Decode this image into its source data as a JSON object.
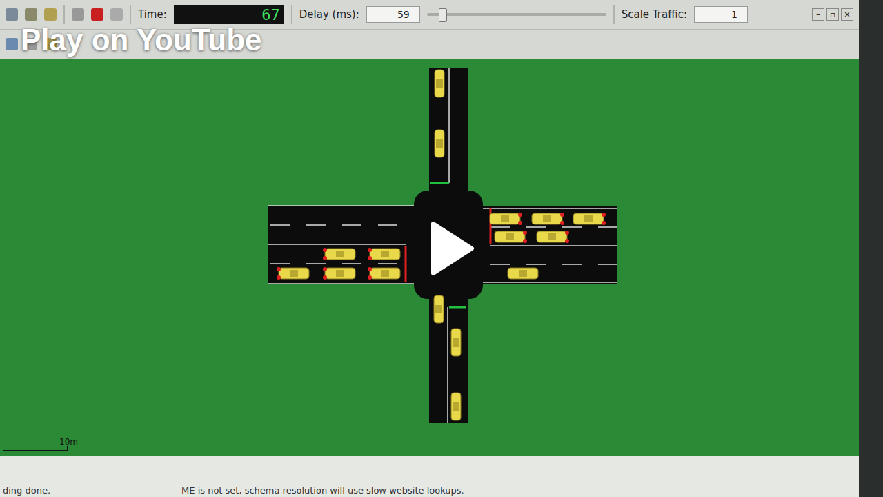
{
  "overlay": {
    "title": "Play on YouTube"
  },
  "toolbar": {
    "time_label": "Time:",
    "time_value": "67",
    "delay_label": "Delay (ms):",
    "delay_value": "59",
    "delay_level": 0.085,
    "scale_label": "Scale Traffic:",
    "scale_value": "1"
  },
  "window_buttons": [
    "–",
    "▫",
    "×"
  ],
  "canvas": {
    "scale_label": "10m"
  },
  "signals": [
    {
      "approach": "west",
      "color": "#e02020"
    },
    {
      "approach": "east",
      "color": "#e02020"
    },
    {
      "approach": "north",
      "color": "#22c040"
    },
    {
      "approach": "south",
      "color": "#22c040"
    }
  ],
  "vehicles": [
    {
      "heading": "east",
      "braking": true
    },
    {
      "heading": "east",
      "braking": true
    },
    {
      "heading": "east",
      "braking": true
    },
    {
      "heading": "east",
      "braking": true
    },
    {
      "heading": "east",
      "braking": true
    },
    {
      "heading": "west",
      "braking": true
    },
    {
      "heading": "west",
      "braking": true
    },
    {
      "heading": "west",
      "braking": true
    },
    {
      "heading": "west",
      "braking": true
    },
    {
      "heading": "west",
      "braking": true
    },
    {
      "heading": "east",
      "braking": false
    },
    {
      "heading": "south",
      "braking": false
    },
    {
      "heading": "south",
      "braking": false
    },
    {
      "heading": "south",
      "braking": false
    },
    {
      "heading": "north",
      "braking": false
    },
    {
      "heading": "north",
      "braking": false
    }
  ],
  "status_bar": {
    "lines": [
      "ding done.",
      "ME is not set, schema resolution will use slow website lookups."
    ]
  }
}
